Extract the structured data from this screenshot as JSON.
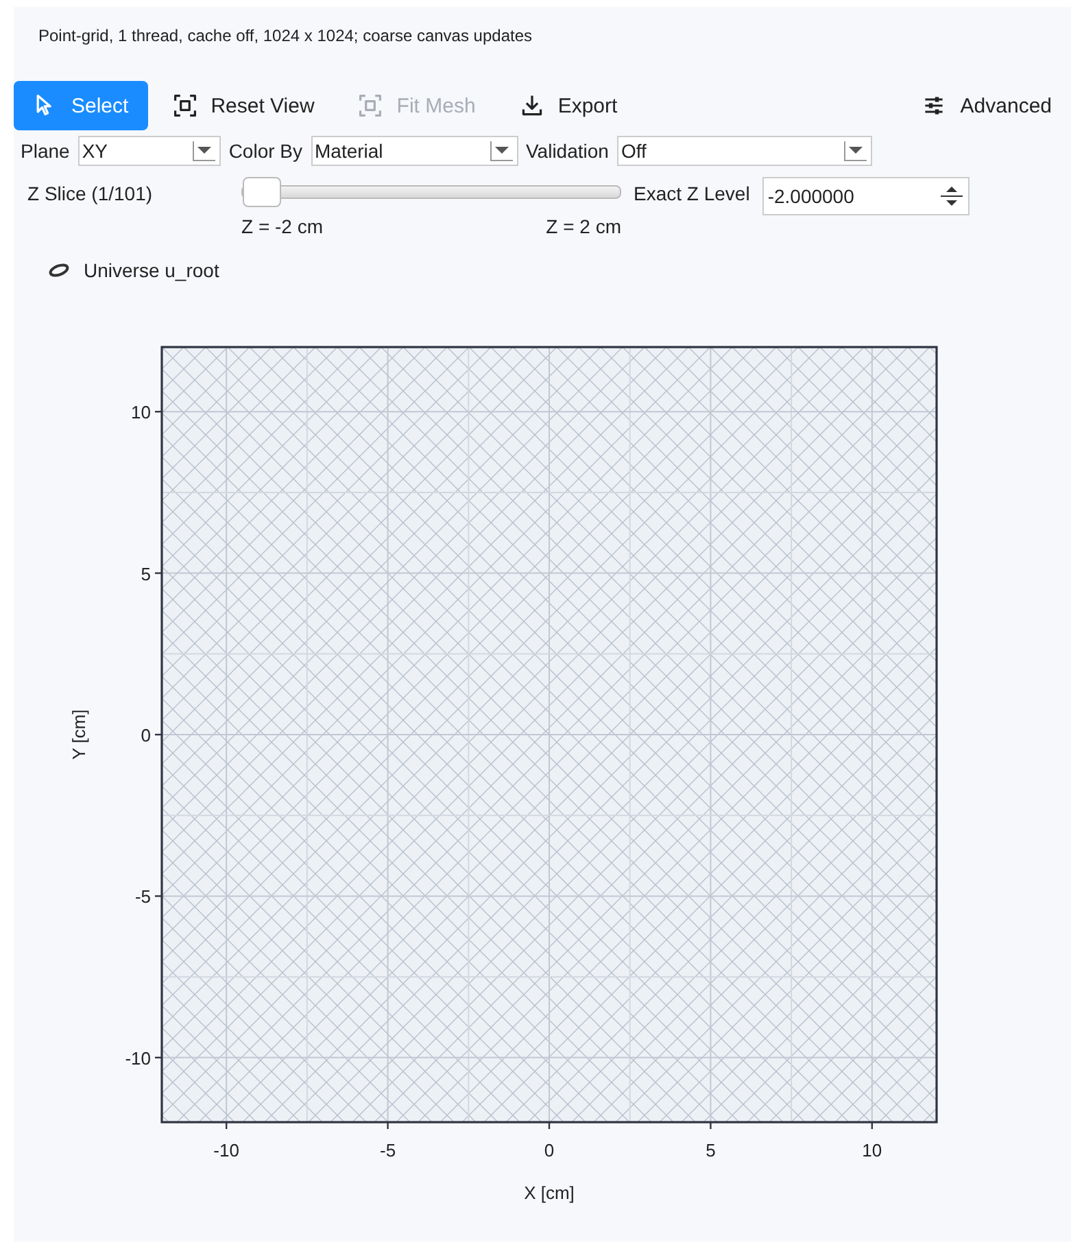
{
  "caption": "Point-grid, 1 thread, cache off, 1024 x 1024; coarse canvas updates",
  "toolbar": [
    {
      "label": "Select",
      "selected": true,
      "disabled": false
    },
    {
      "label": "Reset View",
      "selected": false,
      "disabled": false
    },
    {
      "label": "Fit Mesh",
      "selected": false,
      "disabled": true
    },
    {
      "label": "Export",
      "selected": false,
      "disabled": false
    }
  ],
  "advanced_button": {
    "label": "Advanced"
  },
  "selectors": [
    {
      "label": "Plane",
      "value": "XY"
    },
    {
      "label": "Color By",
      "value": "Material"
    },
    {
      "label": "Validation",
      "value": "Off"
    }
  ],
  "z_slice": {
    "label": "Z Slice (1/101)",
    "level": 0,
    "min_label": "Z = -2 cm",
    "max_label": "Z = 2 cm"
  },
  "exact_z": {
    "label": "Exact Z Level",
    "value": "-2.000000"
  },
  "universe": {
    "label": "Universe u_root"
  },
  "plot": {
    "chart_data": {
      "type": "scatter",
      "xlabel": "X [cm]",
      "ylabel": "Y [cm]",
      "xlim": [
        -12,
        12
      ],
      "ylim": [
        -12,
        12
      ],
      "grid": true,
      "xticks": [
        -10,
        -5,
        0,
        5,
        10
      ],
      "yticks": [
        -10,
        -5,
        0,
        5,
        10
      ]
    }
  }
}
